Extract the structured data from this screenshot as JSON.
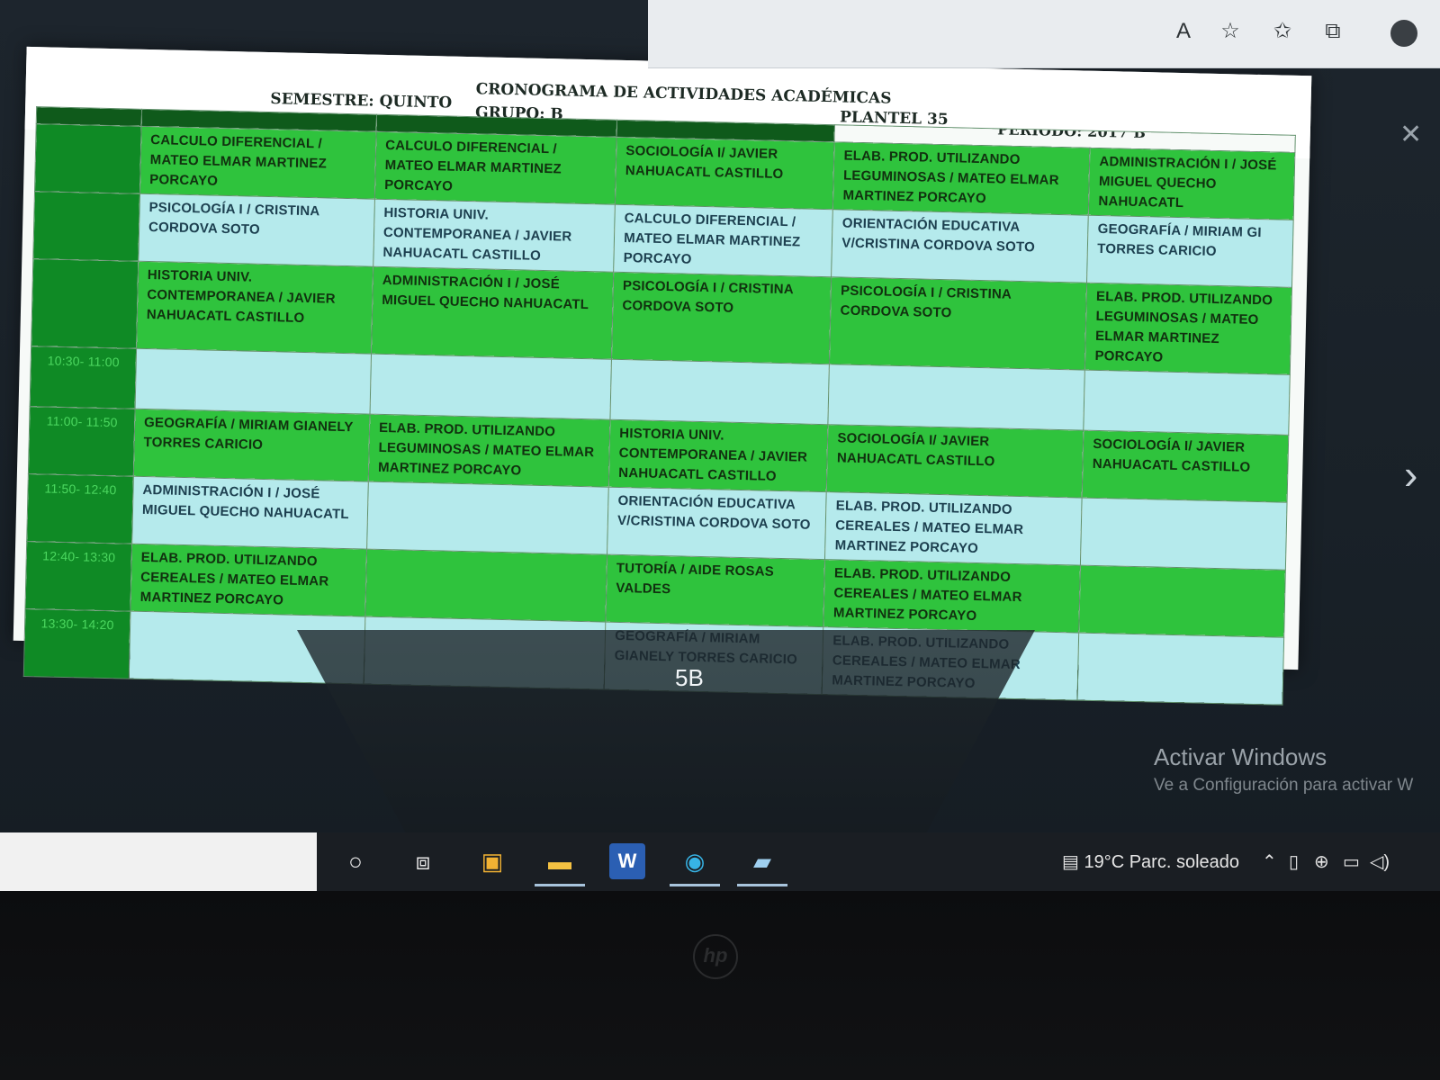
{
  "browser": {
    "toolbar_icons": [
      "read-aloud-icon",
      "add-favorite-icon",
      "favorites-icon",
      "collections-icon"
    ]
  },
  "sheet": {
    "semestre": "SEMESTRE: QUINTO",
    "title": "CRONOGRAMA DE ACTIVIDADES ACADÉMICAS",
    "grupo": "GRUPO: B",
    "plantel": "PLANTEL 35",
    "periodo": "PERIODO: 2017 B"
  },
  "schedule": {
    "rows": [
      {
        "time": "",
        "cells": [
          {
            "text": "CALCULO DIFERENCIAL / MATEO ELMAR MARTINEZ PORCAYO",
            "tone": "g"
          },
          {
            "text": "CALCULO DIFERENCIAL / MATEO ELMAR MARTINEZ PORCAYO",
            "tone": "g"
          },
          {
            "text": "SOCIOLOGÍA I/ JAVIER NAHUACATL CASTILLO",
            "tone": "g"
          },
          {
            "text": "ELAB. PROD. UTILIZANDO LEGUMINOSAS / MATEO ELMAR MARTINEZ PORCAYO",
            "tone": "g"
          },
          {
            "text": "ADMINISTRACIÓN I / JOSÉ MIGUEL QUECHO NAHUACATL",
            "tone": "g"
          }
        ]
      },
      {
        "time": "",
        "cells": [
          {
            "text": "PSICOLOGÍA I / CRISTINA CORDOVA SOTO",
            "tone": "c"
          },
          {
            "text": "HISTORIA UNIV. CONTEMPORANEA / JAVIER NAHUACATL CASTILLO",
            "tone": "c"
          },
          {
            "text": "CALCULO DIFERENCIAL / MATEO ELMAR MARTINEZ PORCAYO",
            "tone": "c"
          },
          {
            "text": "ORIENTACIÓN EDUCATIVA V/CRISTINA CORDOVA SOTO",
            "tone": "c"
          },
          {
            "text": "GEOGRAFÍA / MIRIAM GI TORRES CARICIO",
            "tone": "c"
          }
        ]
      },
      {
        "time": "",
        "cells": [
          {
            "text": "HISTORIA UNIV. CONTEMPORANEA / JAVIER NAHUACATL CASTILLO",
            "tone": "g"
          },
          {
            "text": "ADMINISTRACIÓN I / JOSÉ MIGUEL QUECHO NAHUACATL",
            "tone": "g"
          },
          {
            "text": "PSICOLOGÍA I / CRISTINA CORDOVA SOTO",
            "tone": "g"
          },
          {
            "text": "PSICOLOGÍA I / CRISTINA CORDOVA SOTO",
            "tone": "g"
          },
          {
            "text": "ELAB. PROD. UTILIZANDO LEGUMINOSAS / MATEO ELMAR MARTINEZ PORCAYO",
            "tone": "g"
          }
        ]
      },
      {
        "time": "10:30- 11:00",
        "cells": [
          {
            "text": "",
            "tone": "c"
          },
          {
            "text": "",
            "tone": "c"
          },
          {
            "text": "",
            "tone": "c"
          },
          {
            "text": "",
            "tone": "c"
          },
          {
            "text": "",
            "tone": "c"
          }
        ]
      },
      {
        "time": "11:00- 11:50",
        "cells": [
          {
            "text": "GEOGRAFÍA / MIRIAM GIANELY TORRES CARICIO",
            "tone": "g"
          },
          {
            "text": "ELAB. PROD. UTILIZANDO LEGUMINOSAS / MATEO ELMAR MARTINEZ PORCAYO",
            "tone": "g"
          },
          {
            "text": "HISTORIA UNIV. CONTEMPORANEA / JAVIER NAHUACATL CASTILLO",
            "tone": "g"
          },
          {
            "text": "SOCIOLOGÍA I/ JAVIER NAHUACATL CASTILLO",
            "tone": "g"
          },
          {
            "text": "SOCIOLOGÍA I/ JAVIER NAHUACATL CASTILLO",
            "tone": "g"
          }
        ]
      },
      {
        "time": "11:50- 12:40",
        "cells": [
          {
            "text": "ADMINISTRACIÓN I / JOSÉ MIGUEL QUECHO NAHUACATL",
            "tone": "c"
          },
          {
            "text": "",
            "tone": "c"
          },
          {
            "text": "ORIENTACIÓN EDUCATIVA V/CRISTINA CORDOVA SOTO",
            "tone": "c"
          },
          {
            "text": "ELAB. PROD. UTILIZANDO CEREALES / MATEO ELMAR MARTINEZ PORCAYO",
            "tone": "c"
          },
          {
            "text": "",
            "tone": "c"
          }
        ]
      },
      {
        "time": "12:40- 13:30",
        "cells": [
          {
            "text": "ELAB. PROD. UTILIZANDO CEREALES / MATEO ELMAR MARTINEZ PORCAYO",
            "tone": "g"
          },
          {
            "text": "",
            "tone": "g"
          },
          {
            "text": "TUTORÍA / AIDE ROSAS VALDES",
            "tone": "g"
          },
          {
            "text": "ELAB. PROD. UTILIZANDO CEREALES / MATEO ELMAR MARTINEZ PORCAYO",
            "tone": "g"
          },
          {
            "text": "",
            "tone": "g"
          }
        ]
      },
      {
        "time": "13:30- 14:20",
        "cells": [
          {
            "text": "",
            "tone": "c"
          },
          {
            "text": "",
            "tone": "c"
          },
          {
            "text": "GEOGRAFÍA / MIRIAM GIANELY TORRES CARICIO",
            "tone": "c"
          },
          {
            "text": "ELAB. PROD. UTILIZANDO CEREALES / MATEO ELMAR MARTINEZ PORCAYO",
            "tone": "c"
          },
          {
            "text": "",
            "tone": "c"
          }
        ]
      }
    ]
  },
  "viewer": {
    "caption": "5B"
  },
  "watermark": {
    "title": "Activar Windows",
    "subtitle": "Ve a Configuración para activar W"
  },
  "taskbar": {
    "apps": [
      "cortana-icon",
      "task-view-icon",
      "store-icon",
      "file-explorer-icon",
      "word-icon",
      "edge-icon",
      "photos-icon"
    ],
    "weather": "19°C  Parc. soleado"
  },
  "colors": {
    "green": "#2fc33d",
    "cyan": "#b5eaec",
    "time_green": "#0f8a25",
    "header_bar": "#0f5a1b"
  }
}
